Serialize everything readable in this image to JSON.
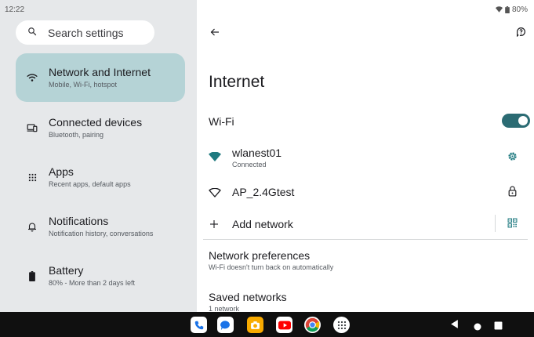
{
  "status_bar": {
    "time": "12:22",
    "battery": "80%"
  },
  "sidebar": {
    "search_placeholder": "Search settings",
    "items": [
      {
        "title": "Network and Internet",
        "subtitle": "Mobile, Wi-Fi, hotspot",
        "icon": "wifi-icon",
        "active": true
      },
      {
        "title": "Connected devices",
        "subtitle": "Bluetooth, pairing",
        "icon": "connected-devices-icon"
      },
      {
        "title": "Apps",
        "subtitle": "Recent apps, default apps",
        "icon": "apps-grid-icon"
      },
      {
        "title": "Notifications",
        "subtitle": "Notification history, conversations",
        "icon": "bell-icon"
      },
      {
        "title": "Battery",
        "subtitle": "80% - More than 2 days left",
        "icon": "battery-icon"
      }
    ]
  },
  "main": {
    "title": "Internet",
    "wifi_label": "Wi-Fi",
    "wifi_enabled": true,
    "networks": [
      {
        "name": "wlanest01",
        "status": "Connected",
        "icon": "wifi-signal-filled-icon",
        "action_icon": "gear-icon"
      },
      {
        "name": "AP_2.4Gtest",
        "status": "",
        "icon": "wifi-signal-outline-icon",
        "action_icon": "lock-icon"
      }
    ],
    "add_network_label": "Add network",
    "preferences": {
      "title": "Network preferences",
      "subtitle": "Wi-Fi doesn't turn back on automatically"
    },
    "saved": {
      "title": "Saved networks",
      "subtitle": "1 network"
    }
  },
  "colors": {
    "accent": "#2b6b73",
    "sidebar_bg": "#e6e8ea",
    "active_item_bg": "#b5d3d6",
    "wifi_icon": "#1f7a80"
  },
  "dock": {
    "apps": [
      "phone-app-icon",
      "messages-app-icon",
      "camera-app-icon",
      "youtube-app-icon",
      "chrome-app-icon",
      "app-drawer-icon"
    ]
  }
}
